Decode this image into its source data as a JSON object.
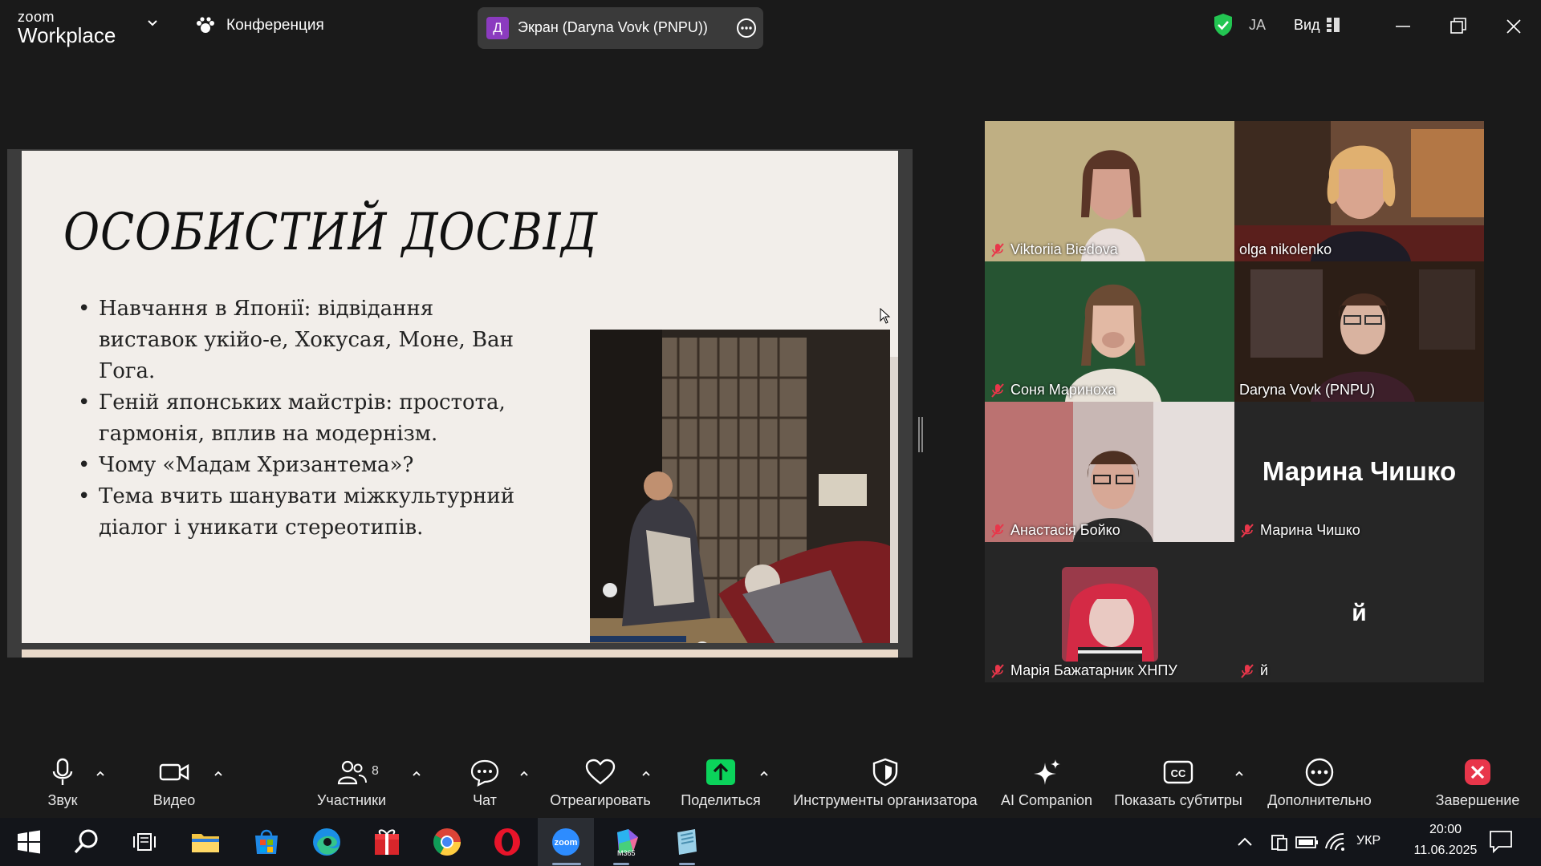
{
  "app": {
    "logo_line1": "zoom",
    "logo_line2": "Workplace",
    "meeting_label": "Конференция",
    "share_avatar_letter": "Д",
    "share_label": "Экран (Daryna Vovk (PNPU))",
    "encryption_color": "#23c552",
    "user_initials": "JA",
    "view_label": "Вид"
  },
  "slide": {
    "title": "ОСОБИСТИЙ ДОСВІД",
    "bullets": [
      "Навчання в Японії: відвідання виставок укійо-е, Хокусая, Моне, Ван Гога.",
      "Геній японських майстрів: простота, гармонія, вплив на модернізм.",
      "Чому «Мадам Хризантема»?",
      "Тема вчить шанувати міжкультурний діалог і уникати стереотипів."
    ]
  },
  "participants": [
    {
      "name": "Viktoriia Biedova",
      "muted": true,
      "video": true
    },
    {
      "name": "olga nikolenko",
      "muted": false,
      "video": true
    },
    {
      "name": "Соня Мариноха",
      "muted": true,
      "video": true
    },
    {
      "name": "Daryna Vovk (PNPU)",
      "muted": false,
      "video": true,
      "speaking": true
    },
    {
      "name": "Анастасія Бойко",
      "muted": true,
      "video": true
    },
    {
      "name": "Марина Чишко",
      "muted": true,
      "video": false,
      "display_name": "Марина Чишко"
    },
    {
      "name": "Марія Бажатарник ХНПУ",
      "muted": true,
      "video": false
    },
    {
      "name": "й",
      "muted": true,
      "video": false,
      "display_name": "й"
    }
  ],
  "toolbar": {
    "audio": "Звук",
    "video": "Видео",
    "participants": "Участники",
    "participants_count": "8",
    "chat": "Чат",
    "react": "Отреагировать",
    "share": "Поделиться",
    "host_tools": "Инструменты организатора",
    "ai": "AI Companion",
    "captions": "Показать субтитры",
    "more": "Дополнительно",
    "end": "Завершение",
    "share_color": "#0bd35b",
    "end_color": "#e8364a"
  },
  "taskbar": {
    "language": "УКР",
    "time": "20:00",
    "date": "11.06.2025",
    "m365_label": "M365"
  }
}
